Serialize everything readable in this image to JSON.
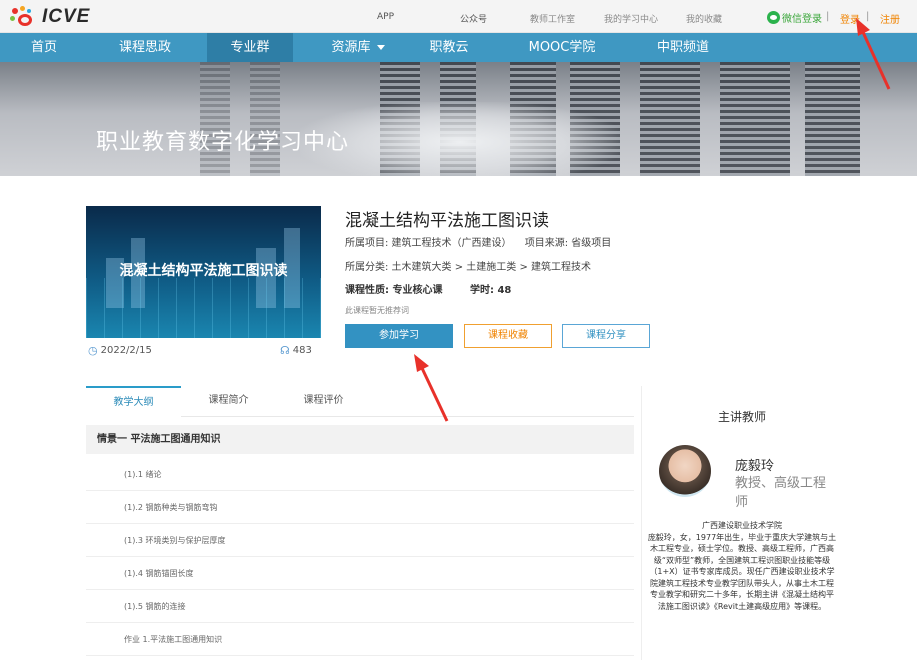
{
  "header": {
    "logo_text": "icve",
    "links": [
      "APP",
      "公众号",
      "教师工作室",
      "我的学习中心",
      "我的收藏"
    ],
    "wechat_login": "微信登录",
    "separator": "|",
    "login": "登录",
    "register": "注册"
  },
  "nav": {
    "items": [
      "首页",
      "课程思政",
      "专业群",
      "资源库",
      "职教云",
      "MOOC学院",
      "中职频道"
    ],
    "active_index": 2
  },
  "banner": {
    "title": "职业教育数字化学习中心"
  },
  "course": {
    "cover_title": "混凝土结构平法施工图识读",
    "date": "2022/2/15",
    "learners": "483",
    "title": "混凝土结构平法施工图识读",
    "project": "所属项目: 建筑工程技术（广西建设）",
    "source": "项目来源: 省级项目",
    "category": "所属分类: 土木建筑大类 > 土建施工类 > 建筑工程技术",
    "nature": "课程性质: 专业核心课",
    "hours": "学时: 48",
    "no_recommend": "此课程暂无推荐词",
    "btn_join": "参加学习",
    "btn_fav": "课程收藏",
    "btn_share": "课程分享"
  },
  "tabs": [
    "教学大纲",
    "课程简介",
    "课程评价"
  ],
  "outline": {
    "chapter": "情景一  平法施工图通用知识",
    "lessons": [
      "(1).1  绪论",
      "(1).2  钢筋种类与钢筋弯钩",
      "(1).3  环境类别与保护层厚度",
      "(1).4  钢筋锚固长度",
      "(1).5  钢筋的连接",
      "作业  1.平法施工图通用知识"
    ]
  },
  "teacher": {
    "heading": "主讲教师",
    "name": "庞毅玲",
    "title": "教授、高级工程师",
    "bio": "广西建设职业技术学院\n庞毅玲，女，1977年出生，毕业于重庆大学建筑与土木工程专业，硕士学位。教授、高级工程师，广西高级“双师型”教师，全国建筑工程识图职业技能等级（1+X）证书专家库成员。现任广西建设职业技术学院建筑工程技术专业教学团队带头人，从事土木工程专业教学和研究二十多年，长期主讲《混凝土结构平法施工图识读》《Revit土建高级应用》等课程。"
  },
  "colors": {
    "nav_bg": "#3f98c2",
    "nav_active": "#2e7ea6",
    "join_btn": "#3392c2",
    "fav_border": "#f0a030",
    "login": "#f08300",
    "annotation_arrow": "#e8312a"
  },
  "icons": [
    "logo-icon",
    "wechat-icon",
    "caret-down-icon",
    "calendar-icon",
    "user-icon",
    "arrow-annotation"
  ]
}
